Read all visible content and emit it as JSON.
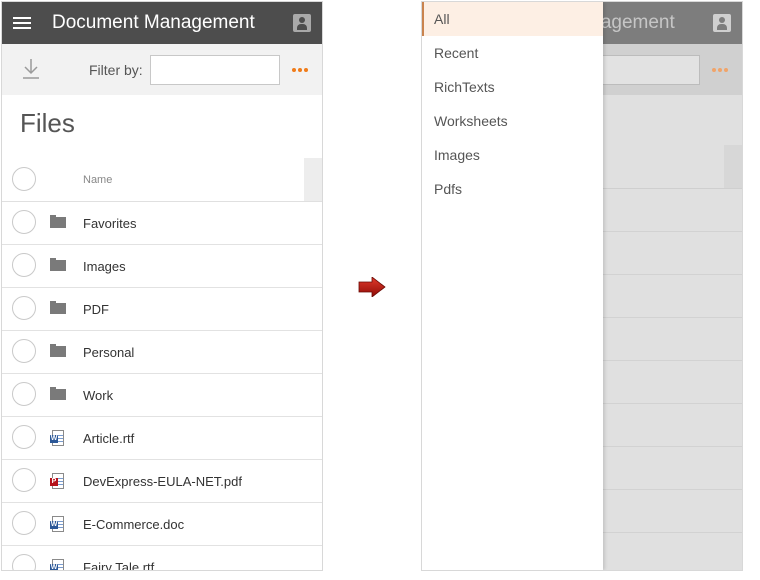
{
  "app": {
    "title": "Document Management"
  },
  "toolbar": {
    "filter_label": "Filter by:",
    "filter_value": "",
    "filter_placeholder": ""
  },
  "page": {
    "title": "Files"
  },
  "list": {
    "column_name": "Name",
    "items": [
      {
        "name": "Favorites",
        "type": "folder"
      },
      {
        "name": "Images",
        "type": "folder"
      },
      {
        "name": "PDF",
        "type": "folder"
      },
      {
        "name": "Personal",
        "type": "folder"
      },
      {
        "name": "Work",
        "type": "folder"
      },
      {
        "name": "Article.rtf",
        "type": "word-doc"
      },
      {
        "name": "DevExpress-EULA-NET.pdf",
        "type": "pdf-doc"
      },
      {
        "name": "E-Commerce.doc",
        "type": "word-doc"
      },
      {
        "name": "Fairy Tale.rtf",
        "type": "word-doc"
      }
    ]
  },
  "drawer": {
    "items": [
      {
        "label": "All",
        "selected": true
      },
      {
        "label": "Recent",
        "selected": false
      },
      {
        "label": "RichTexts",
        "selected": false
      },
      {
        "label": "Worksheets",
        "selected": false
      },
      {
        "label": "Images",
        "selected": false
      },
      {
        "label": "Pdfs",
        "selected": false
      }
    ]
  },
  "colors": {
    "appbar": "#4d4d4d",
    "accent": "#f07c1a",
    "selected_bg": "#fdefe4",
    "arrow": "#c00000"
  },
  "icons": {
    "menu": "hamburger-menu-icon",
    "profile": "profile-icon",
    "download": "download-icon",
    "more": "more-options-icon",
    "folder": "folder-icon",
    "word": "word-document-icon",
    "pdf": "pdf-document-icon",
    "arrow": "right-arrow-icon"
  }
}
